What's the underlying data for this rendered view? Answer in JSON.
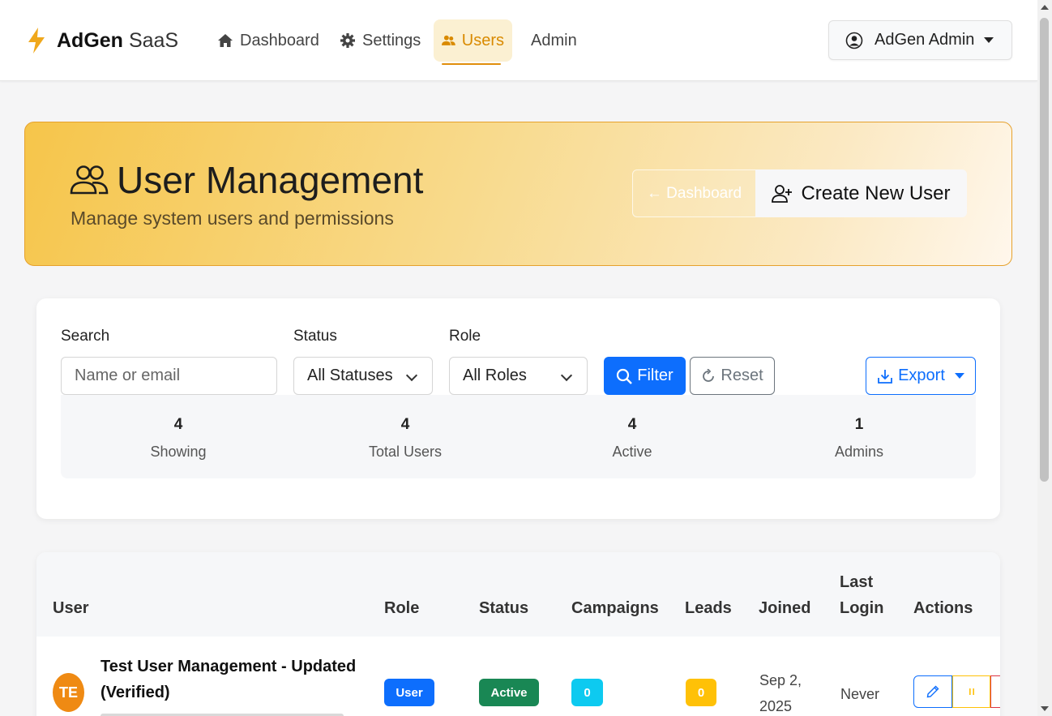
{
  "brand": {
    "name_strong": "AdGen",
    "name_light": "SaaS"
  },
  "nav": {
    "items": [
      {
        "label": "Dashboard",
        "icon": "home-icon"
      },
      {
        "label": "Settings",
        "icon": "gear-icon"
      },
      {
        "label": "Users",
        "icon": "users-icon",
        "active": true
      },
      {
        "label": "Admin"
      }
    ],
    "user_menu": {
      "label": "AdGen Admin",
      "icon": "user-circle-icon"
    }
  },
  "hero": {
    "title": "User Management",
    "subtitle": "Manage system users and permissions",
    "back_button": "← Dashboard",
    "create_button": "Create New User"
  },
  "filters": {
    "search": {
      "label": "Search",
      "placeholder": "Name or email"
    },
    "status": {
      "label": "Status",
      "value": "All Statuses"
    },
    "role": {
      "label": "Role",
      "value": "All Roles"
    },
    "filter_button": "Filter",
    "reset_button": "Reset",
    "export_button": "Export"
  },
  "stats": [
    {
      "value": "4",
      "label": "Showing"
    },
    {
      "value": "4",
      "label": "Total Users"
    },
    {
      "value": "4",
      "label": "Active"
    },
    {
      "value": "1",
      "label": "Admins"
    }
  ],
  "table": {
    "headers": {
      "user": "User",
      "role": "Role",
      "status": "Status",
      "campaigns": "Campaigns",
      "leads": "Leads",
      "joined": "Joined",
      "last_login_1": "Last",
      "last_login_2": "Login",
      "actions": "Actions"
    },
    "rows": [
      {
        "initials": "TE",
        "name": "Test User Management - Updated (Verified)",
        "role": "User",
        "status": "Active",
        "campaigns": "0",
        "leads": "0",
        "joined_1": "Sep 2,",
        "joined_2": "2025",
        "last_login": "Never"
      }
    ]
  },
  "colors": {
    "accent": "#e08e0b",
    "primary": "#0d6efd",
    "success": "#198754",
    "info": "#0dcaf0",
    "warning": "#ffc107",
    "avatar": "#ef8a13"
  }
}
